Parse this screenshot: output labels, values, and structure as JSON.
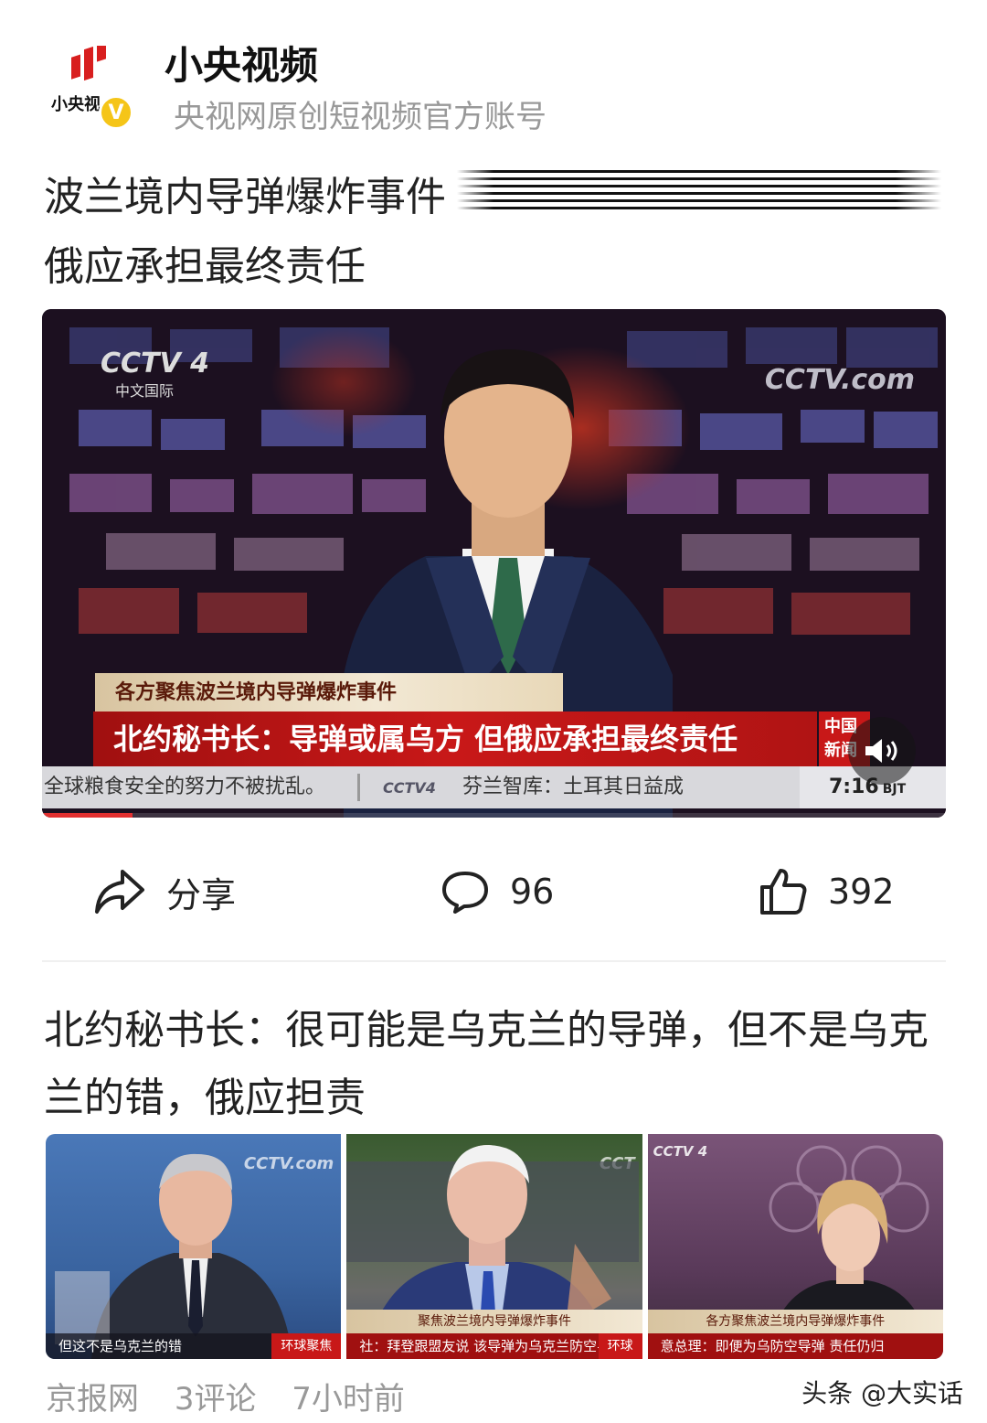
{
  "account": {
    "name": "小央视频",
    "description": "央视网原创短视频官方账号",
    "avatar_text": "小央视",
    "verified_mark": "V"
  },
  "post": {
    "title_line1": "波兰境内导弹爆炸事件",
    "title_line2": "俄应承担最终责任",
    "video": {
      "channel_bug": "CCTV 4",
      "channel_sub": "中文国际",
      "watermark": "CCTV.com",
      "lower_third_top": "各方聚焦波兰境内导弹爆炸事件",
      "lower_third_main": "北约秘书长：导弹或属乌方 但俄应承担最终责任",
      "news_logo": "中国新闻",
      "ticker_left": "全球粮食安全的努力不被扰乱。",
      "ticker_logo": "CCTV4",
      "ticker_right": "芬兰智库：土耳其日益成",
      "time": "7:16",
      "time_zone": "BJT",
      "progress_fraction": 0.1
    },
    "actions": {
      "share_label": "分享",
      "comment_count": "96",
      "like_count": "392"
    }
  },
  "related": {
    "title": "北约秘书长：很可能是乌克兰的导弹，但不是乌克兰的错，俄应担责",
    "thumbnails": [
      {
        "caption": "但这不是乌克兰的错",
        "tag": "环球聚焦",
        "bug": "CCTV.com"
      },
      {
        "band": "聚焦波兰境内导弹爆炸事件",
        "caption": "社：拜登跟盟友说 该导弹为乌克兰防空导弹",
        "tag": "环球",
        "bug": "CCT"
      },
      {
        "band": "各方聚焦波兰境内导弹爆炸事件",
        "caption": "意总理：即便为乌防空导弹 责任仍归",
        "bug": "CCTV 4"
      }
    ],
    "source": "京报网",
    "comments": "3评论",
    "time": "7小时前"
  },
  "watermark": "头条 @大实话",
  "colors": {
    "accent_red": "#c81818",
    "meta_gray": "#999999",
    "verified": "#f5c518"
  }
}
